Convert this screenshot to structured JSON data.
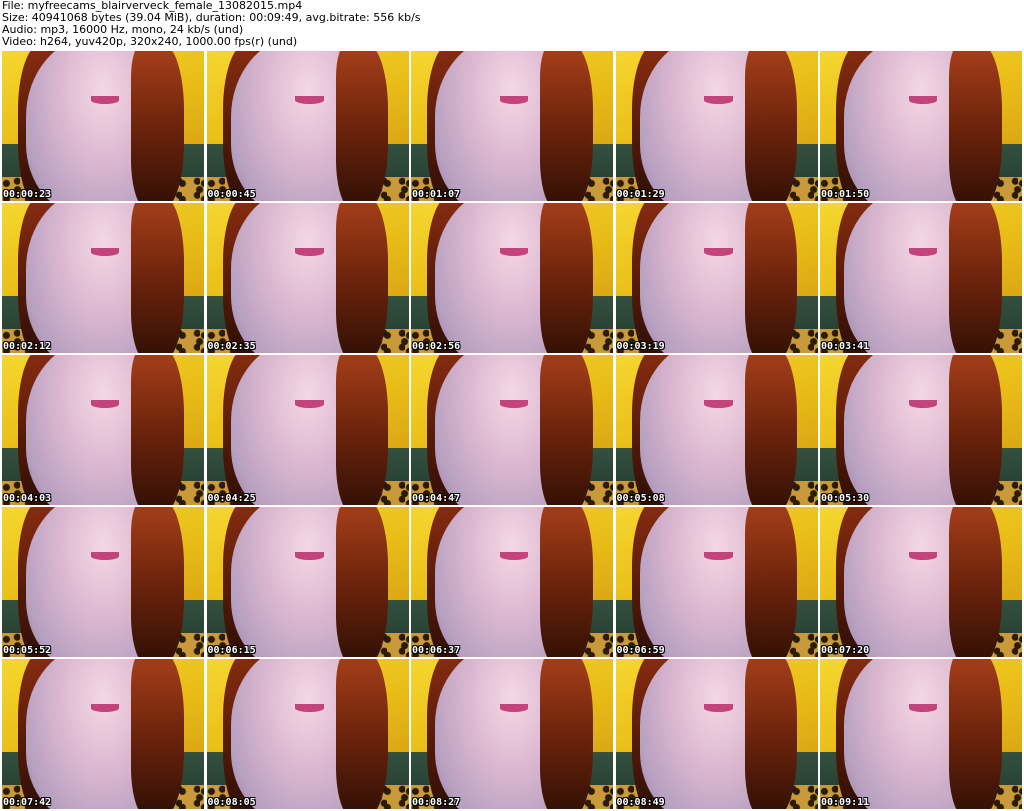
{
  "header": {
    "file": "File: myfreecams_blairverveck_female_13082015.mp4",
    "size": "Size: 40941068 bytes (39.04 MiB), duration: 00:09:49, avg.bitrate: 556 kb/s",
    "audio": "Audio: mp3, 16000 Hz, mono, 24 kb/s (und)",
    "video": "Video: h264, yuv420p, 320x240, 1000.00 fps(r) (und)"
  },
  "thumbnails": [
    {
      "time": "00:00:23"
    },
    {
      "time": "00:00:45"
    },
    {
      "time": "00:01:07"
    },
    {
      "time": "00:01:29"
    },
    {
      "time": "00:01:50"
    },
    {
      "time": "00:02:12"
    },
    {
      "time": "00:02:35"
    },
    {
      "time": "00:02:56"
    },
    {
      "time": "00:03:19"
    },
    {
      "time": "00:03:41"
    },
    {
      "time": "00:04:03"
    },
    {
      "time": "00:04:25"
    },
    {
      "time": "00:04:47"
    },
    {
      "time": "00:05:08"
    },
    {
      "time": "00:05:30"
    },
    {
      "time": "00:05:52"
    },
    {
      "time": "00:06:15"
    },
    {
      "time": "00:06:37"
    },
    {
      "time": "00:06:59"
    },
    {
      "time": "00:07:20"
    },
    {
      "time": "00:07:42"
    },
    {
      "time": "00:08:05"
    },
    {
      "time": "00:08:27"
    },
    {
      "time": "00:08:49"
    },
    {
      "time": "00:09:11"
    }
  ],
  "colors": {
    "background": "#ffffff",
    "header_text": "#000000",
    "timestamp_text": "#ffffff",
    "timestamp_outline": "#000000"
  }
}
